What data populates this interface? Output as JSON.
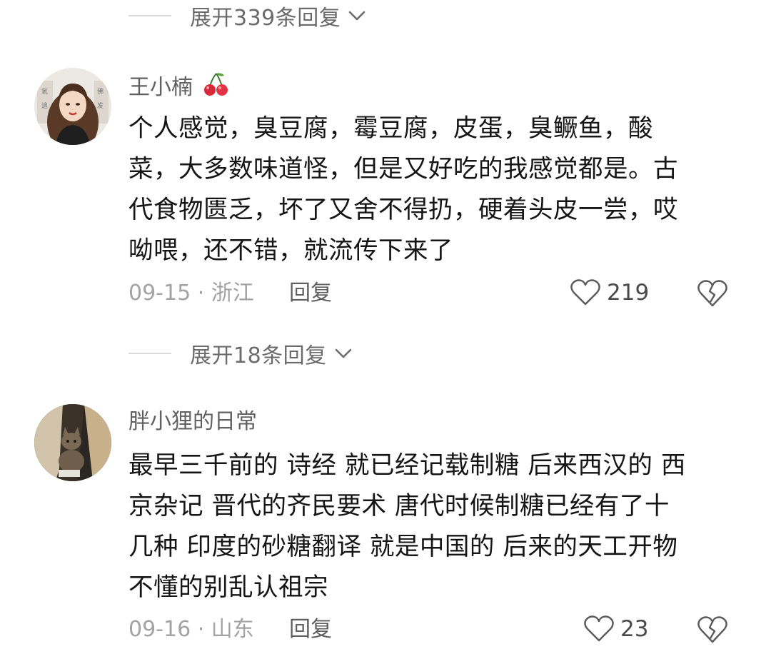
{
  "expand_top": {
    "label": "展开339条回复"
  },
  "expand_middle": {
    "label": "展开18条回复"
  },
  "comments": [
    {
      "username": "王小楠",
      "badge_icon": "cherry-icon",
      "text_lines": [
        "个人感觉，臭豆腐，霉豆腐，皮蛋，臭鳜鱼，酸",
        "菜，大多数味道怪，但是又好吃的我感觉都是。古",
        "代食物匮乏，坏了又舍不得扔，硬着头皮一尝，哎",
        "呦喂，还不错，就流传下来了"
      ],
      "date": "09-15",
      "location": "浙江",
      "reply_label": "回复",
      "likes": "219"
    },
    {
      "username": "胖小狸的日常",
      "text_lines": [
        "最早三千前的 诗经 就已经记载制糖  后来西汉的 西",
        "京杂记 晋代的齐民要术  唐代时候制糖已经有了十",
        "几种 印度的砂糖翻译 就是中国的 后来的天工开物",
        "不懂的别乱认祖宗"
      ],
      "date": "09-16",
      "location": "山东",
      "reply_label": "回复",
      "likes": "23"
    }
  ],
  "colors": {
    "meta_gray": "#a3a3a3",
    "name_gray": "#616161",
    "cherry_red": "#d8283a"
  }
}
